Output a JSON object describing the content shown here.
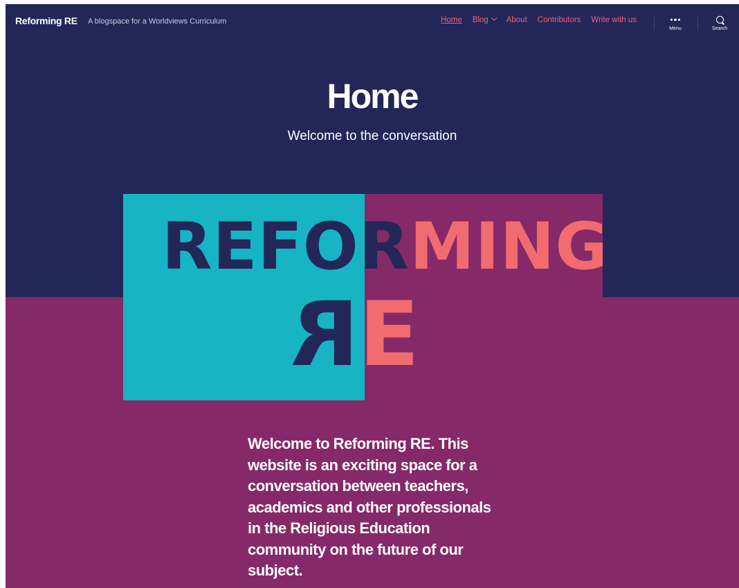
{
  "header": {
    "site_title": "Reforming RE",
    "site_description": "A blogspace for a Worldviews Curriculum",
    "nav": [
      {
        "label": "Home",
        "active": true
      },
      {
        "label": "Blog",
        "has_dropdown": true
      },
      {
        "label": "About"
      },
      {
        "label": "Contributors"
      },
      {
        "label": "Write with us"
      }
    ],
    "menu_label": "Menu",
    "search_label": "Search"
  },
  "hero": {
    "title": "Home",
    "subtitle": "Welcome to the conversation"
  },
  "logo": {
    "word_dark": "REFOR",
    "word_coral": "MING",
    "re_mirrored": "R",
    "re_e": "E"
  },
  "content": {
    "welcome_text": "Welcome to Reforming RE. This website is an exciting space for a conversation between teachers, academics and other professionals in the Religious Education community on the future of our subject."
  },
  "colors": {
    "navy": "#222757",
    "plum": "#852969",
    "teal": "#17b4c4",
    "coral": "#f26b6f",
    "nav_link": "#f2607b"
  }
}
